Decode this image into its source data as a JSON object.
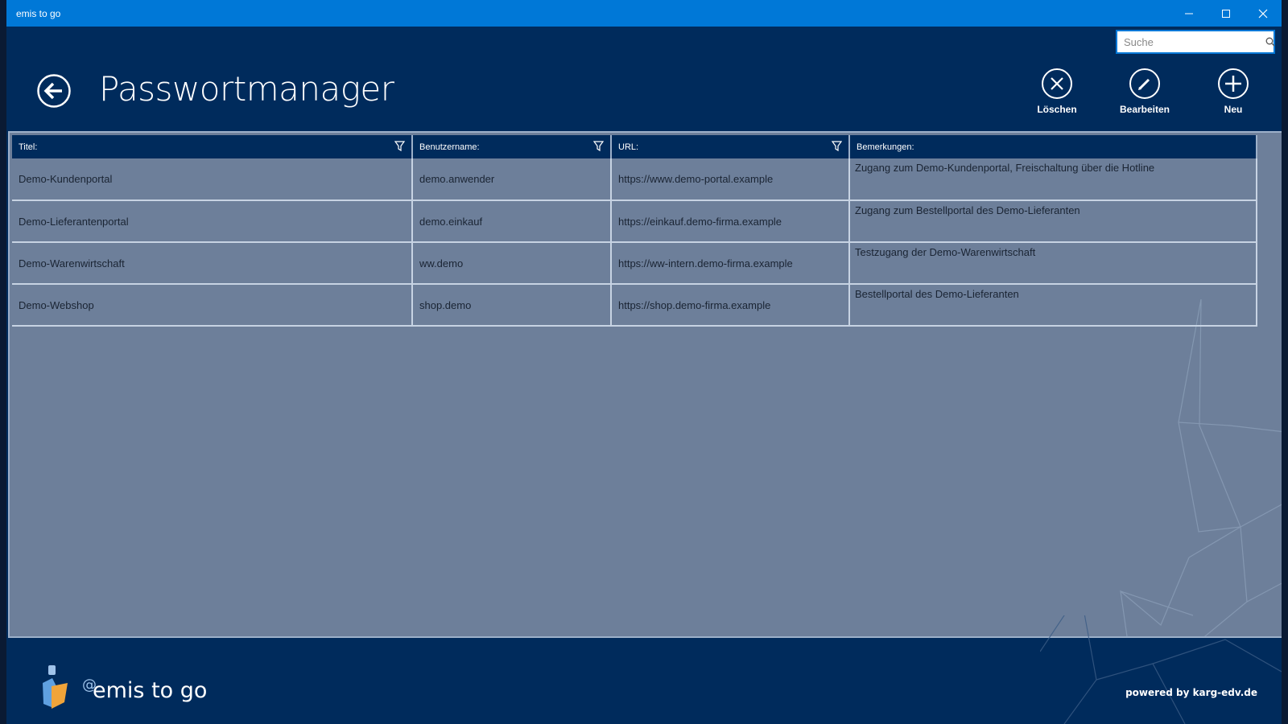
{
  "window": {
    "title": "emis to go"
  },
  "search": {
    "placeholder": "Suche"
  },
  "page": {
    "title": "Passwortmanager"
  },
  "toolbar": {
    "delete_label": "Löschen",
    "edit_label": "Bearbeiten",
    "new_label": "Neu"
  },
  "grid": {
    "columns": [
      "Titel:",
      "Benutzername:",
      "URL:",
      "Bemerkungen:"
    ],
    "rows": [
      {
        "title": "Demo-Kundenportal",
        "user": "demo.anwender",
        "url": "https://www.demo-portal.example",
        "note": "Zugang zum Demo-Kundenportal, Freischaltung über die Hotline"
      },
      {
        "title": "Demo-Lieferantenportal",
        "user": "demo.einkauf",
        "url": "https://einkauf.demo-firma.example",
        "note": "Zugang zum Bestellportal des Demo-Lieferanten"
      },
      {
        "title": "Demo-Warenwirtschaft",
        "user": "ww.demo",
        "url": "https://ww-intern.demo-firma.example",
        "note": "Testzugang der Demo-Warenwirtschaft"
      },
      {
        "title": "Demo-Webshop",
        "user": "shop.demo",
        "url": "https://shop.demo-firma.example",
        "note": "Bestellportal des Demo-Lieferanten"
      }
    ]
  },
  "footer": {
    "logo_text": "emis to go",
    "powered_by": "powered by karg-edv.de"
  },
  "colors": {
    "titlebar": "#0078d7",
    "header_bg": "#002b5c",
    "grid_bg": "#6d7f9a"
  }
}
